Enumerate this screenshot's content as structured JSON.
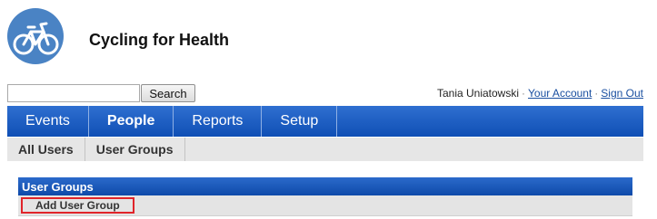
{
  "site": {
    "title": "Cycling for Health",
    "logo_icon": "bicycle-icon",
    "logo_color": "#4a83c4"
  },
  "search": {
    "value": "",
    "placeholder": "",
    "button_label": "Search"
  },
  "user": {
    "name": "Tania Uniatowski",
    "separator": "·",
    "account_link": "Your Account",
    "signout_link": "Sign Out"
  },
  "main_nav": {
    "items": [
      {
        "label": "Events",
        "active": false
      },
      {
        "label": "People",
        "active": true
      },
      {
        "label": "Reports",
        "active": false
      },
      {
        "label": "Setup",
        "active": false
      }
    ],
    "color": "#1a5cc2"
  },
  "sub_nav": {
    "items": [
      {
        "label": "All Users",
        "active": false
      },
      {
        "label": "User Groups",
        "active": true
      }
    ]
  },
  "panel": {
    "title": "User Groups",
    "add_button_label": "Add User Group",
    "highlight_color": "#e0242a"
  }
}
